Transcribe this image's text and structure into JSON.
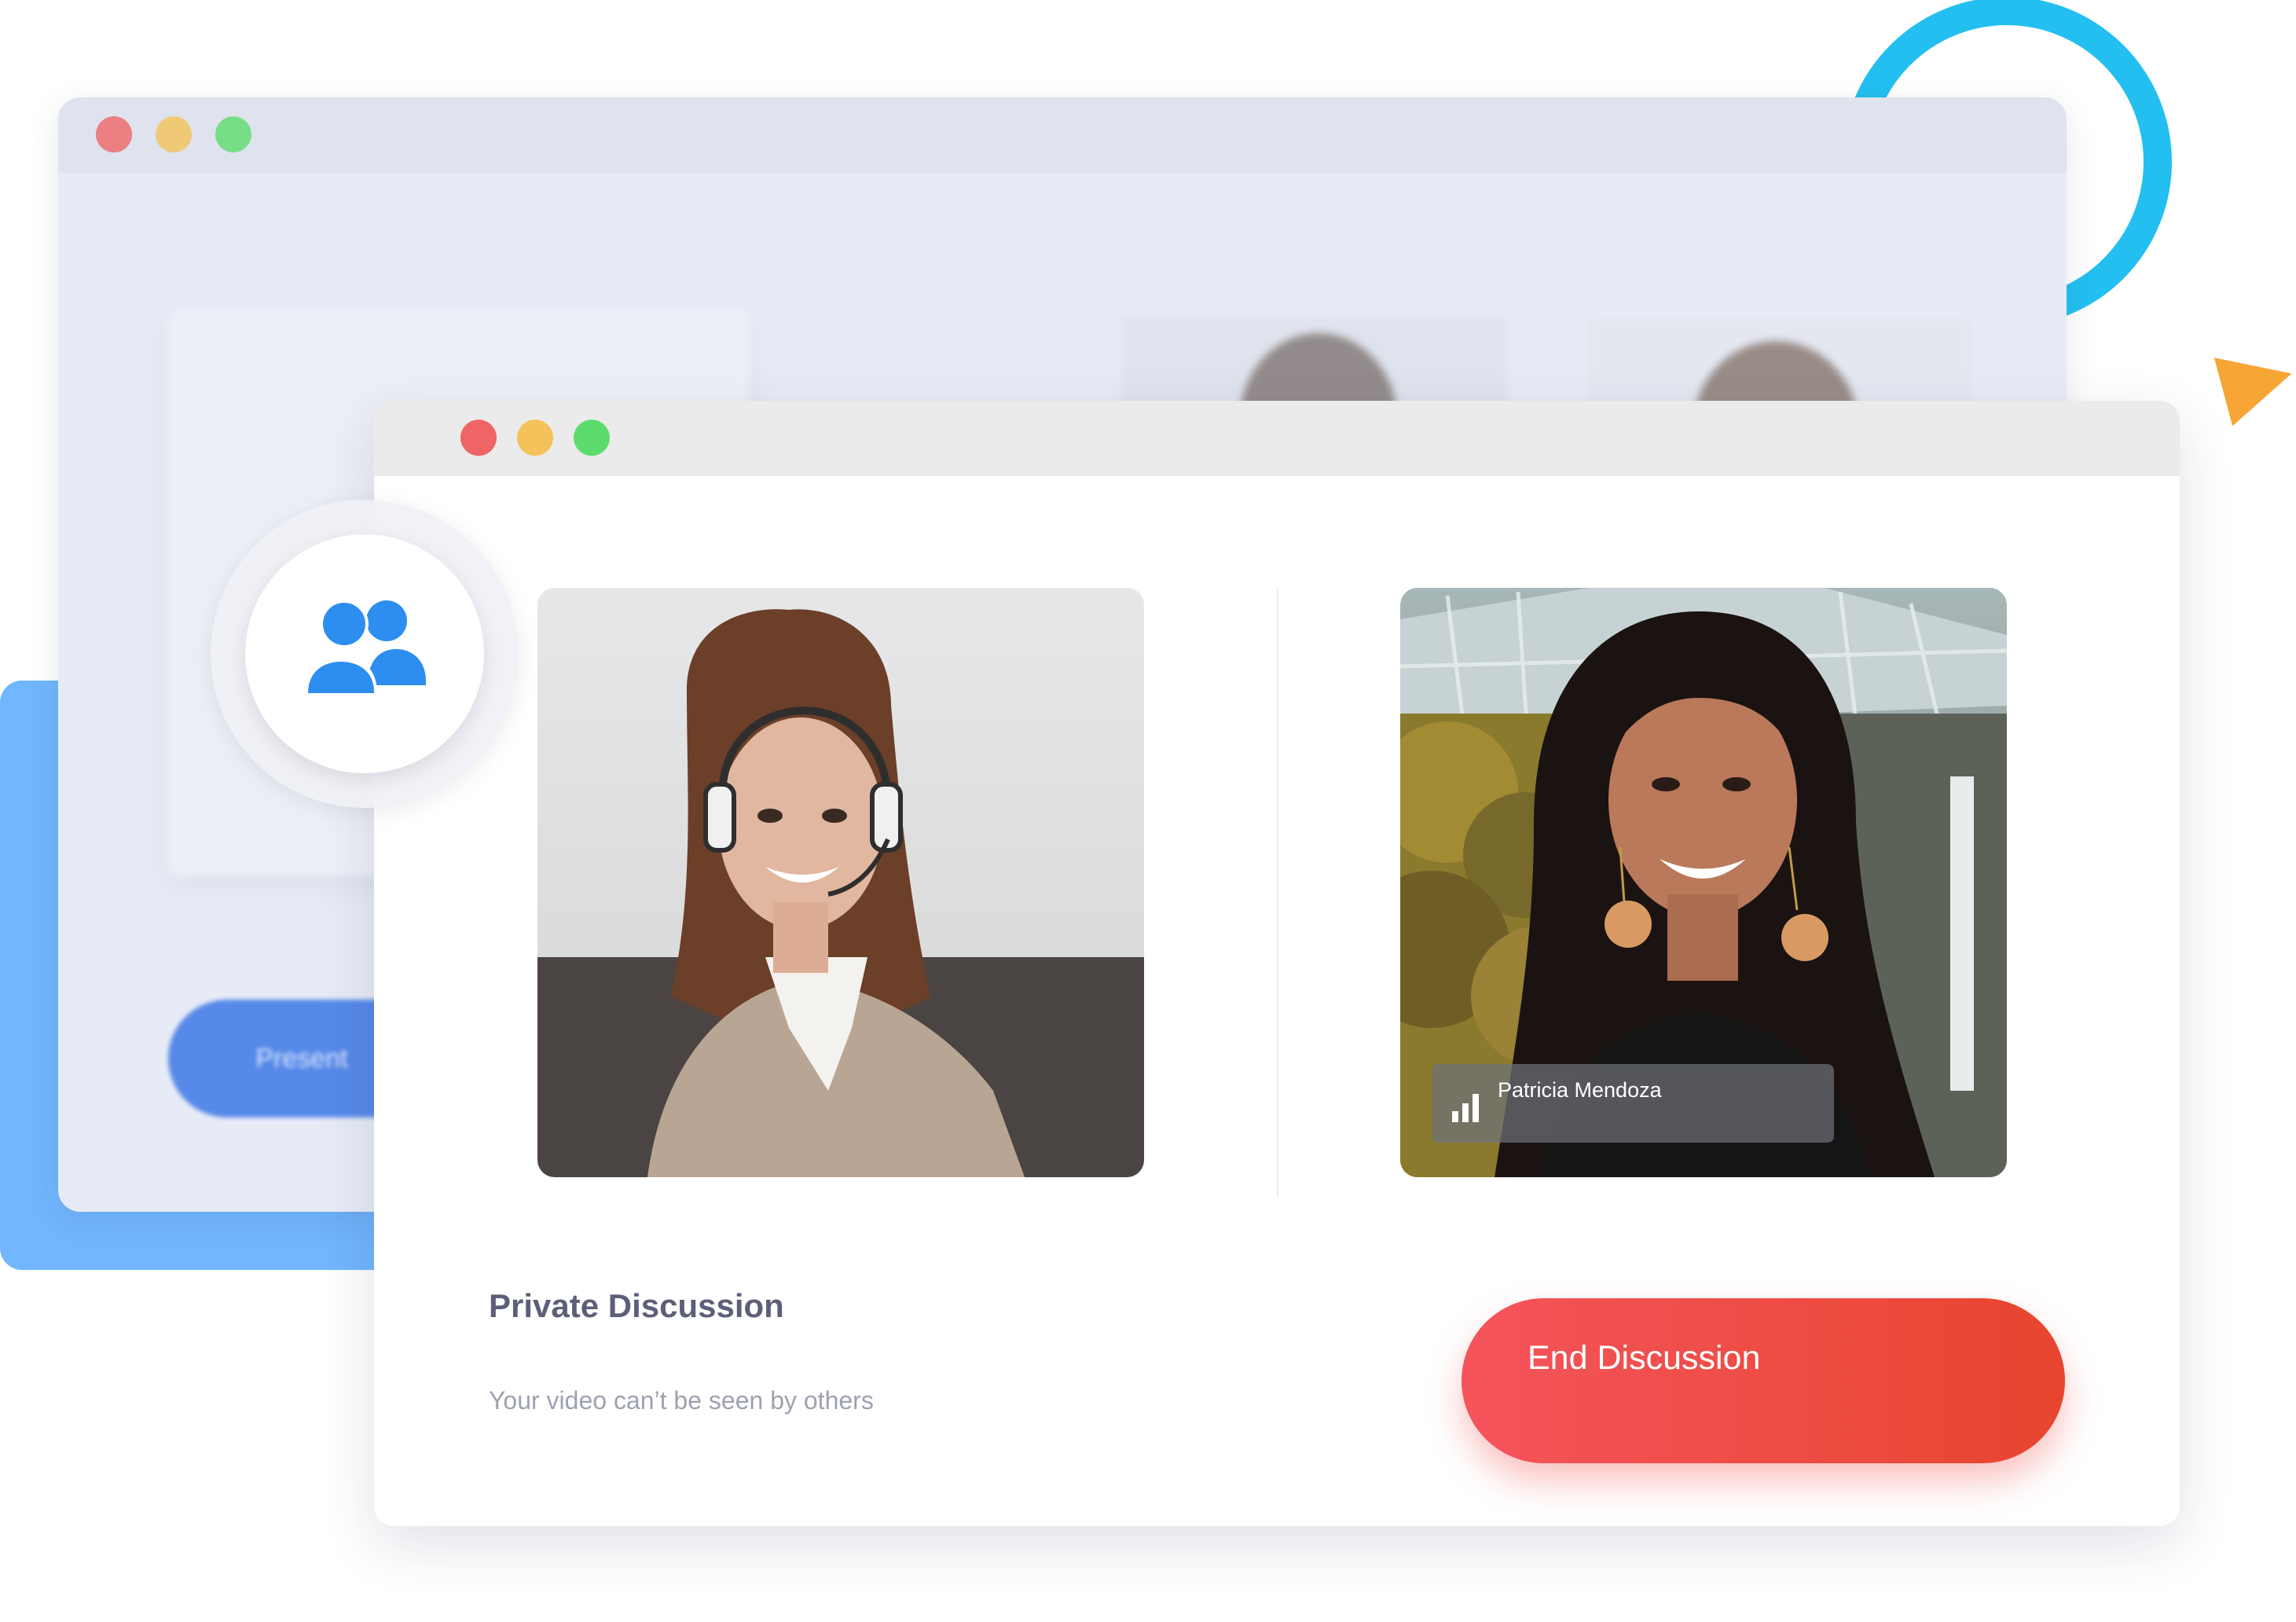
{
  "colors": {
    "accent_ring": "#22bff0",
    "accent_triangle": "#f7a535",
    "panel_blue": "#71b6ff",
    "window_close": "#ef6566",
    "window_minimize": "#f4c258",
    "window_maximize": "#5ddc6e",
    "end_button_start": "#f5545c",
    "end_button_end": "#e7452e"
  },
  "back_window": {
    "present_label": "Present"
  },
  "badge": {
    "icon": "group-users-icon"
  },
  "call": {
    "participants": [
      {
        "role": "self",
        "image": "woman-with-headset-photo"
      },
      {
        "role": "remote",
        "image": "smiling-woman-photo",
        "name": "Patricia Mendoza",
        "signal_icon": "signal-bars-icon"
      }
    ],
    "title": "Private Discussion",
    "subtitle": "Your video can’t be seen by others",
    "end_label": "End Discussion"
  }
}
